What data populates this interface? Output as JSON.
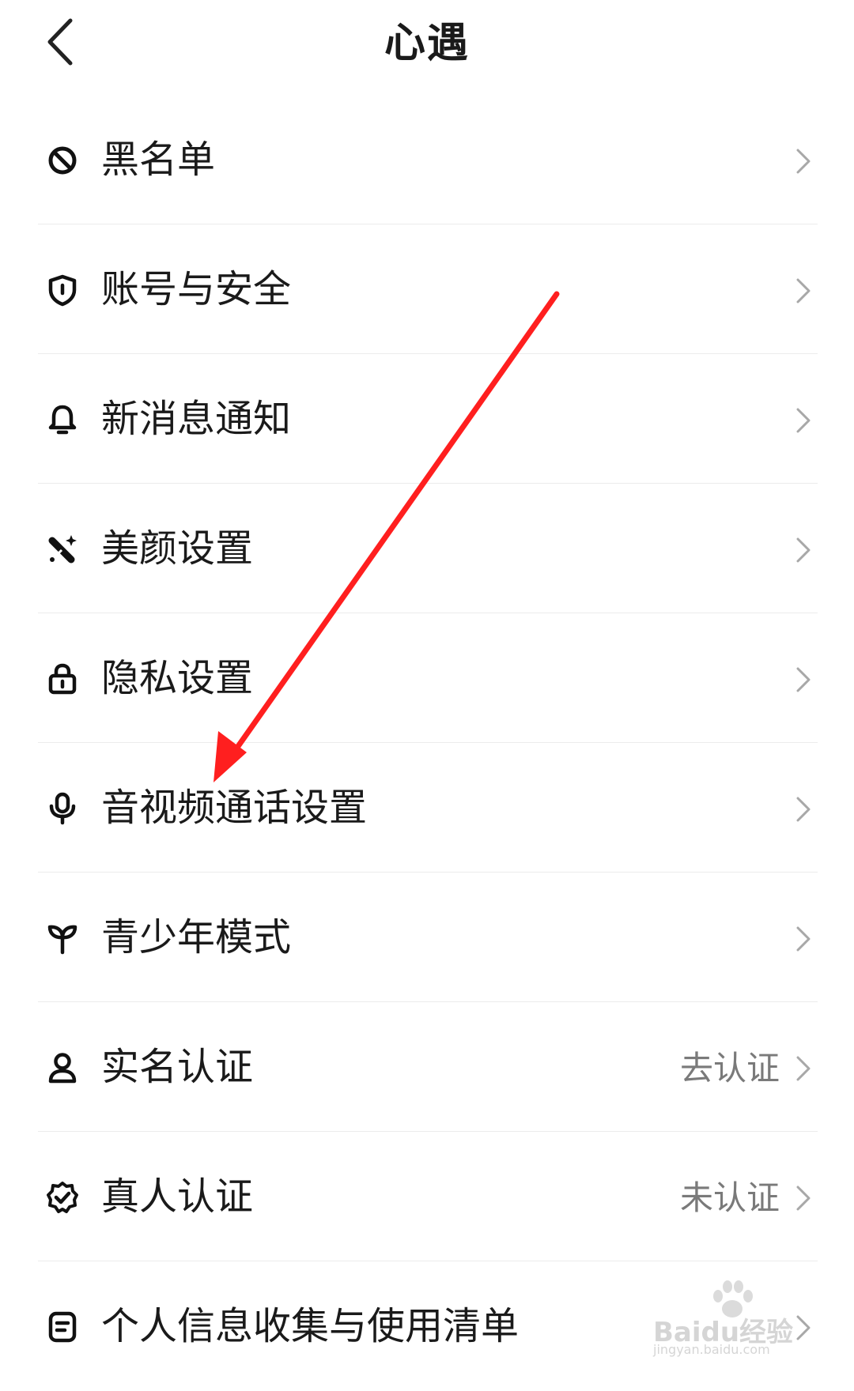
{
  "header": {
    "title": "心遇",
    "back_icon": "chevron-left-icon"
  },
  "menu": [
    {
      "label": "黑名单",
      "icon": "block-icon",
      "status": ""
    },
    {
      "label": "账号与安全",
      "icon": "shield-icon",
      "status": ""
    },
    {
      "label": "新消息通知",
      "icon": "bell-icon",
      "status": ""
    },
    {
      "label": "美颜设置",
      "icon": "beauty-wand-icon",
      "status": ""
    },
    {
      "label": "隐私设置",
      "icon": "lock-icon",
      "status": ""
    },
    {
      "label": "音视频通话设置",
      "icon": "microphone-icon",
      "status": ""
    },
    {
      "label": "青少年模式",
      "icon": "sprout-icon",
      "status": ""
    },
    {
      "label": "实名认证",
      "icon": "person-icon",
      "status": "去认证"
    },
    {
      "label": "真人认证",
      "icon": "verified-badge-icon",
      "status": "未认证"
    },
    {
      "label": "个人信息收集与使用清单",
      "icon": "document-icon",
      "status": ""
    }
  ],
  "annotation": {
    "color": "#ff1f1f"
  },
  "watermark": {
    "text": "Baidu经验",
    "url_text": "jingyan.baidu.com"
  }
}
